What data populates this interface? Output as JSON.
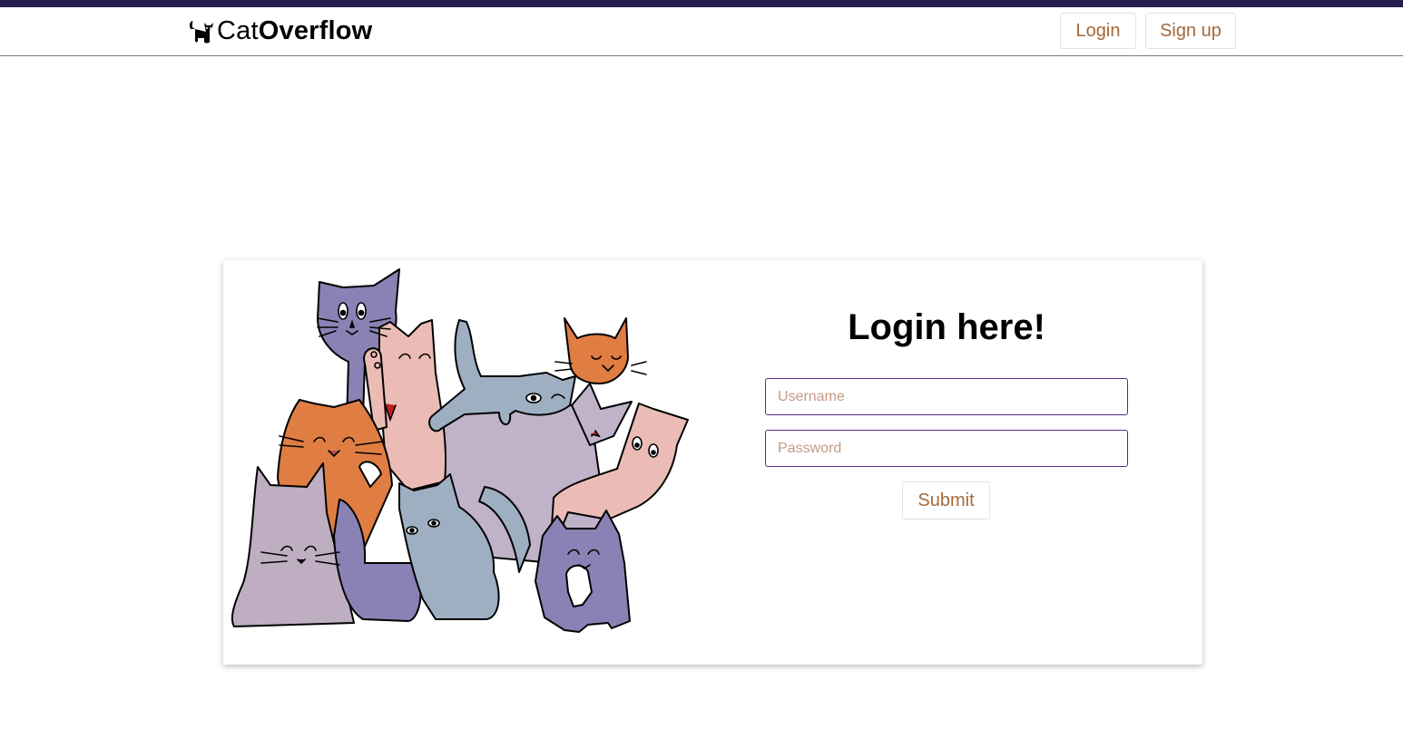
{
  "header": {
    "brand_light": "Cat",
    "brand_bold": "Overflow",
    "login_label": "Login",
    "signup_label": "Sign up"
  },
  "form": {
    "title": "Login here!",
    "username_placeholder": "Username",
    "password_placeholder": "Password",
    "submit_label": "Submit"
  },
  "illustration": {
    "icon": "cats-group-illustration",
    "palette": [
      "#8a82b4",
      "#e07d43",
      "#ebbcb6",
      "#9eafc2",
      "#bfaec2",
      "#c0b2c8"
    ]
  },
  "colors": {
    "topbar": "#261f4f",
    "accent_text": "#a4693a",
    "input_border": "#5b2a8c"
  }
}
